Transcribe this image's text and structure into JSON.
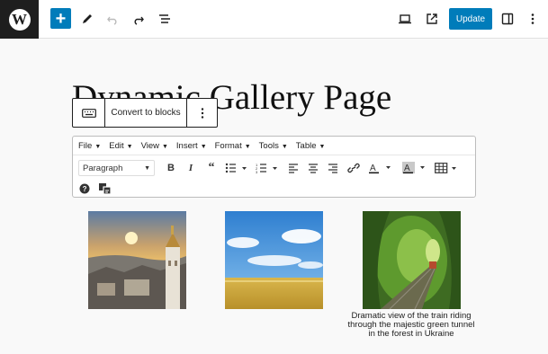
{
  "header": {
    "logo_icon": "wordpress-logo",
    "update_label": "Update",
    "accent_color": "#007cba"
  },
  "page": {
    "title": "Dynamic Gallery Page"
  },
  "block_toolbar": {
    "convert_label": "Convert to blocks"
  },
  "classic_editor": {
    "menus": [
      "File",
      "Edit",
      "View",
      "Insert",
      "Format",
      "Tools",
      "Table"
    ],
    "format_select": "Paragraph"
  },
  "gallery": {
    "images": [
      {
        "caption": ""
      },
      {
        "caption": ""
      },
      {
        "caption": "Dramatic view of the train riding through the majestic green tunnel in the forest in Ukraine"
      }
    ]
  }
}
